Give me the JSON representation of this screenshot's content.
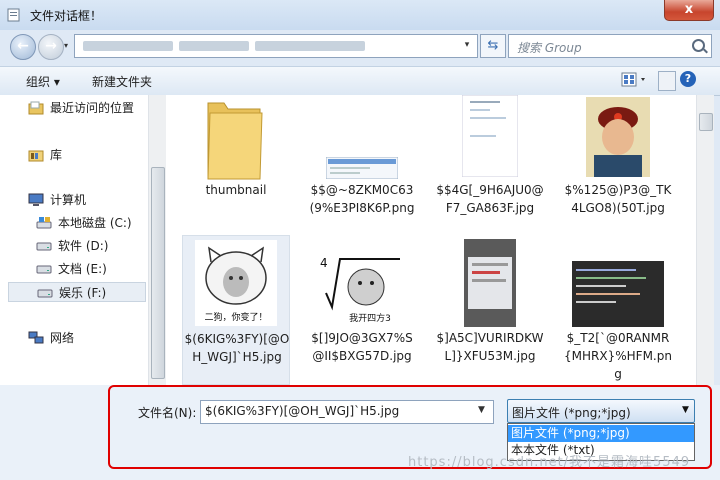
{
  "window": {
    "title": "文件对话框！",
    "close_glyph": "x"
  },
  "address": {
    "history_glyph": "▾",
    "dropdown_glyph": "▾"
  },
  "search": {
    "placeholder": "搜索 Group"
  },
  "toolbar": {
    "organize": "组织 ▾",
    "new_folder": "新建文件夹",
    "help": "?"
  },
  "sidebar": {
    "items": [
      {
        "label": "最近访问的位置",
        "icon": "recent-places-icon"
      },
      {
        "label": "库",
        "icon": "library-icon"
      },
      {
        "label": "计算机",
        "icon": "computer-icon"
      },
      {
        "label": "本地磁盘 (C:)",
        "icon": "drive-c-icon"
      },
      {
        "label": "软件 (D:)",
        "icon": "drive-icon"
      },
      {
        "label": "文档 (E:)",
        "icon": "drive-icon"
      },
      {
        "label": "娱乐 (F:)",
        "icon": "drive-icon",
        "selected": true
      },
      {
        "label": "网络",
        "icon": "network-icon"
      }
    ]
  },
  "files": [
    {
      "name": "thumbnail",
      "type": "folder"
    },
    {
      "name": "$$@~8ZKM0C63(9%E3PI8K6P.png",
      "type": "image"
    },
    {
      "name": "$$4G[_9H6AJU0@F7_GA863F.jpg",
      "type": "image"
    },
    {
      "name": "$%125@)P3@_TK4LGO8)(50T.jpg",
      "type": "image"
    },
    {
      "name": "$(6KIG%3FY)[@OH_WGJ]`H5.jpg",
      "type": "image",
      "selected": true,
      "thumb_text": "二狗，你变了！"
    },
    {
      "name": "$[]9JO@3GX7%S@II$BXG57D.jpg",
      "type": "image",
      "thumb_text": "我开四方3",
      "thumb_num": "4"
    },
    {
      "name": "$]A5C]VURIRDKWL]}XFU53M.jpg",
      "type": "image"
    },
    {
      "name": "$_T2[`@0RANMR{MHRX}%HFM.png",
      "type": "image"
    }
  ],
  "bottom": {
    "filename_label": "文件名(N):",
    "filename_value": "$(6KIG%3FY)[@OH_WGJ]`H5.jpg",
    "filetype_selected": "图片文件 (*png;*jpg)",
    "filetype_options": [
      "图片文件 (*png;*jpg)",
      "本本文件 (*txt)"
    ]
  },
  "watermark": "https://blog.csdn.net/我不是霜海哇5549",
  "colors": {
    "accent_select": "#3399ff",
    "highlight_border": "#e00000",
    "help_blue": "#2563b8"
  }
}
